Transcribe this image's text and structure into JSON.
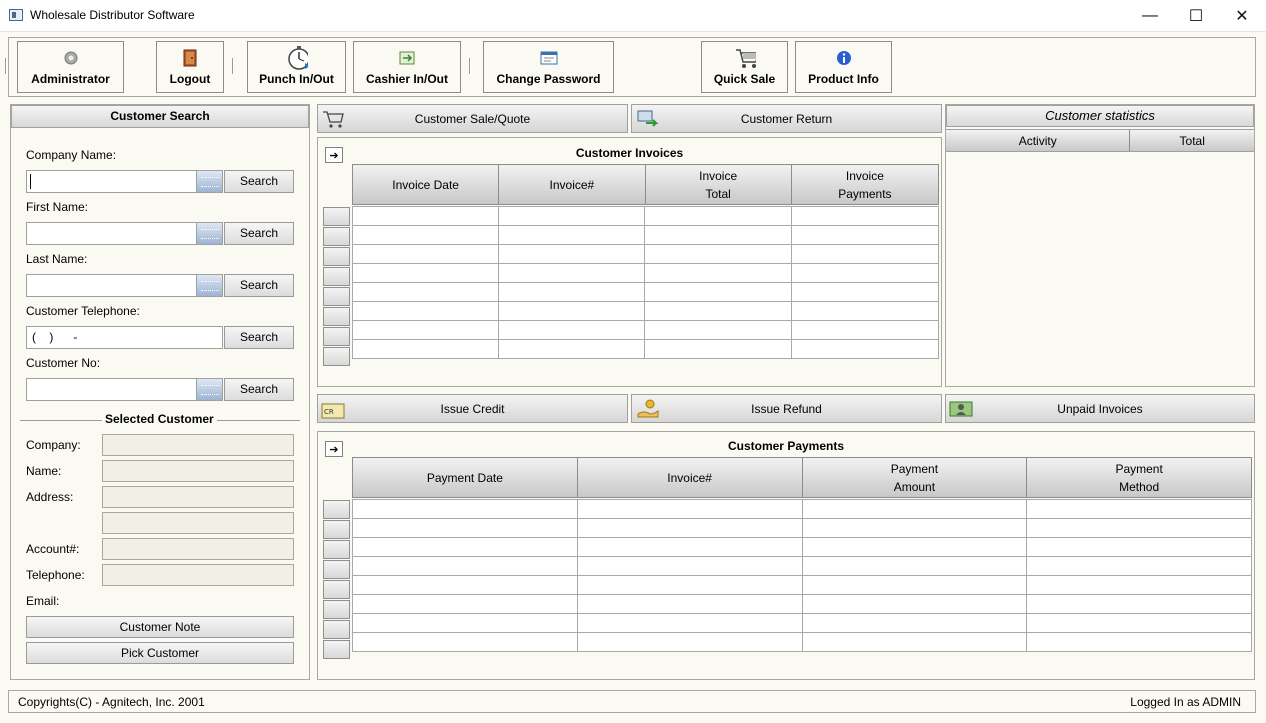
{
  "window": {
    "title": "Wholesale Distributor Software",
    "minimize": "—",
    "maximize": "☐",
    "close": "✕"
  },
  "toolbar": {
    "administrator": "Administrator",
    "logout": "Logout",
    "punch": "Punch In/Out",
    "cashier": "Cashier In/Out",
    "change_password": "Change Password",
    "quick_sale": "Quick Sale",
    "product_info": "Product Info"
  },
  "search": {
    "title": "Customer Search",
    "company_label": "Company Name:",
    "first_label": "First Name:",
    "last_label": "Last Name:",
    "phone_label": "Customer Telephone:",
    "phone_value": "(    )      -",
    "custno_label": "Customer No:",
    "search_btn": "Search"
  },
  "selected": {
    "title": "Selected Customer",
    "company": "Company:",
    "name": "Name:",
    "address": "Address:",
    "account": "Account#:",
    "telephone": "Telephone:",
    "email": "Email:",
    "note_btn": "Customer Note",
    "pick_btn": "Pick Customer"
  },
  "actions": {
    "sale_quote": "Customer Sale/Quote",
    "return": "Customer Return",
    "issue_credit": "Issue Credit",
    "issue_refund": "Issue Refund",
    "unpaid": "Unpaid Invoices"
  },
  "invoices": {
    "title": "Customer Invoices",
    "col1": "Invoice Date",
    "col2": "Invoice#",
    "col3a": "Invoice",
    "col3b": "Total",
    "col4a": "Invoice",
    "col4b": "Payments"
  },
  "payments": {
    "title": "Customer Payments",
    "col1": "Payment Date",
    "col2": "Invoice#",
    "col3a": "Payment",
    "col3b": "Amount",
    "col4a": "Payment",
    "col4b": "Method"
  },
  "stats": {
    "title": "Customer statistics",
    "col1": "Activity",
    "col2": "Total"
  },
  "status": {
    "copyright": "Copyrights(C) - Agnitech, Inc. 2001",
    "logged": "Logged In as ADMIN"
  }
}
